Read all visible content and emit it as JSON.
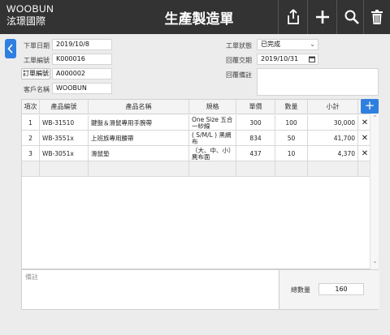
{
  "header": {
    "brand_line1": "WOOBUN",
    "brand_line2": "泫璟國際",
    "title": "生產製造單"
  },
  "toolbar": {
    "icons": [
      "share-icon",
      "add-icon",
      "search-icon",
      "trash-icon"
    ]
  },
  "form": {
    "order_date_label": "下單日期",
    "order_date": "2019/10/8",
    "work_no_label": "工單編號",
    "work_no": "K000016",
    "order_no_btn": "訂單編號",
    "order_no": "A000002",
    "customer_label": "客戶名稱",
    "customer": "WOOBUN",
    "status_label": "工單狀態",
    "status": "已完成",
    "reply_date_label": "回覆交期",
    "reply_date": "2019/10/31",
    "reply_note_label": "回覆備註",
    "reply_note": ""
  },
  "table": {
    "columns": [
      "項次",
      "產品編號",
      "產品名稱",
      "規格",
      "單價",
      "數量",
      "小計"
    ],
    "rows": [
      {
        "idx": "1",
        "code": "WB-31510",
        "name": "鍵盤＆滑鼠專用手腕帶",
        "spec": "One Size 五合一紗線",
        "price": "300",
        "qty": "100",
        "subtotal": "30,000"
      },
      {
        "idx": "2",
        "code": "WB-3551x",
        "name": "上班族專用腰帶",
        "spec": "( S/M/L ) 黑網布",
        "price": "834",
        "qty": "50",
        "subtotal": "41,700"
      },
      {
        "idx": "3",
        "code": "WB-3051x",
        "name": "滑鼠墊",
        "spec": "（大、中、小）麂布面",
        "price": "437",
        "qty": "10",
        "subtotal": "4,370"
      }
    ],
    "delete_glyph": "✕",
    "add_glyph": "+"
  },
  "footer": {
    "notes_label": "備註",
    "total_qty_label": "總數量",
    "total_qty": "160"
  },
  "colors": {
    "topbar": "#333333",
    "accent": "#2e7fe0",
    "background": "#ececec"
  }
}
